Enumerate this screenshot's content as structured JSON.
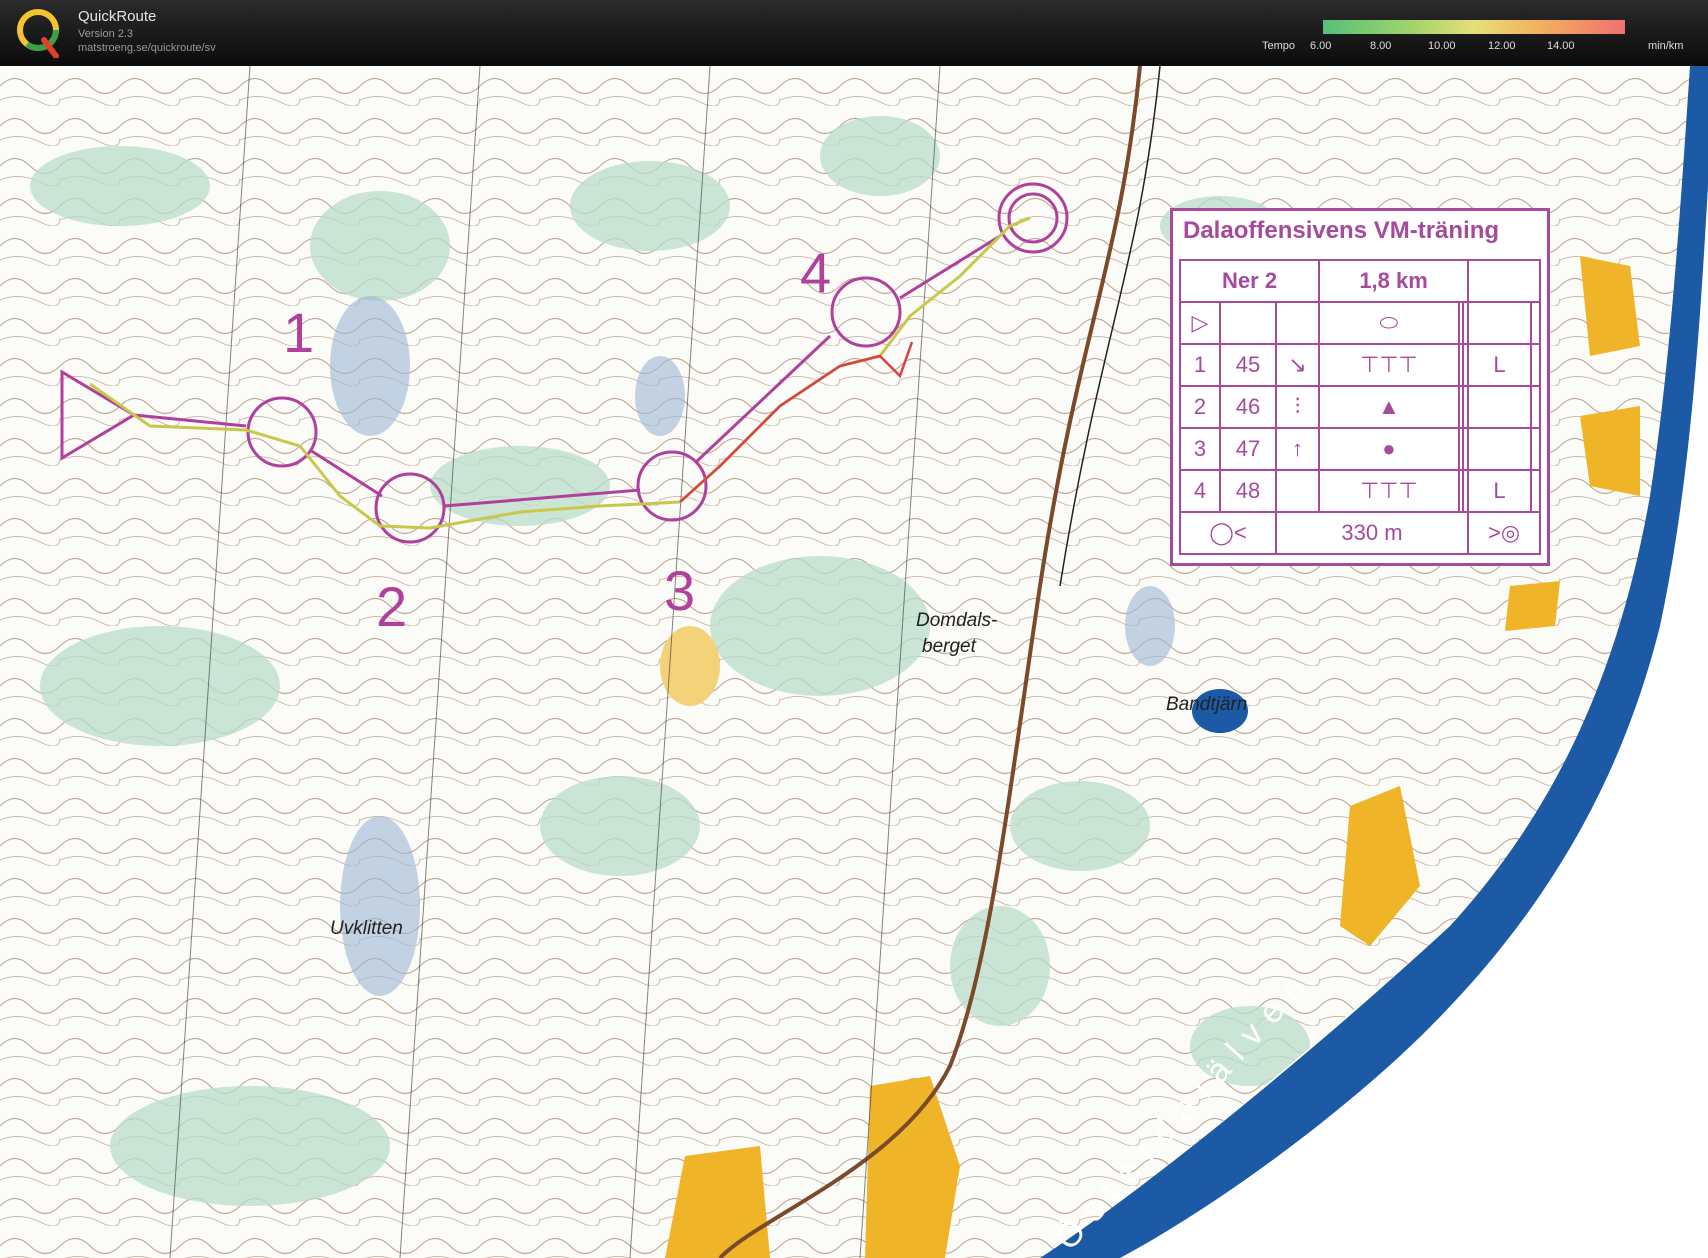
{
  "app": {
    "title": "QuickRoute",
    "version": "Version 2.3",
    "url": "matstroeng.se/quickroute/sv",
    "logo_letter": "Q"
  },
  "tempo": {
    "label": "Tempo",
    "ticks": [
      "6.00",
      "8.00",
      "10.00",
      "12.00",
      "14.00"
    ],
    "unit": "min/km"
  },
  "colors": {
    "course": "#b0409c",
    "route_gps": "#c8c84a",
    "water": "#1c5aa6",
    "open": "#f0b428",
    "forest": "#b9dcc9"
  },
  "map": {
    "controls": [
      "1",
      "2",
      "3",
      "4"
    ],
    "place_names": [
      "Domdals-",
      "berget",
      "Bandtjärn",
      "Uvklitten",
      "Österdalälven"
    ]
  },
  "legend": {
    "title": "Dalaoffensivens VM-träning",
    "class": "Ner 2",
    "length": "1,8 km",
    "rows": [
      {
        "num": "1",
        "code": "45",
        "dir": "↘",
        "feature": "⊤⊤⊤",
        "extra": "L"
      },
      {
        "num": "2",
        "code": "46",
        "dir": "⫶",
        "feature": "▲",
        "extra": ""
      },
      {
        "num": "3",
        "code": "47",
        "dir": "↑",
        "feature": "●",
        "extra": ""
      },
      {
        "num": "4",
        "code": "48",
        "dir": "",
        "feature": "⊤⊤⊤",
        "extra": "L"
      }
    ],
    "finish_distance": "330 m"
  }
}
